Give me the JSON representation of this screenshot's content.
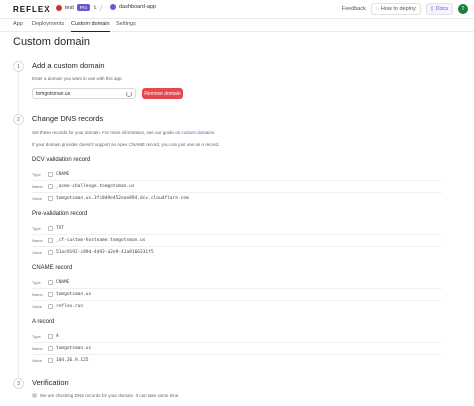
{
  "topbar": {
    "logo": "REFLEX",
    "team": "test",
    "team_badge": "Pro",
    "project": "dashboard-app",
    "feedback": "Feedback",
    "deploy": "How to deploy",
    "docs": "Docs",
    "user_initial": "T"
  },
  "tabs": [
    "App",
    "Deployments",
    "Custom domain",
    "Settings"
  ],
  "page_title": "Custom domain",
  "steps": [
    {
      "num": "1",
      "title": "Add a custom domain",
      "desc": "Enter a domain you want to use with this app."
    },
    {
      "num": "2",
      "title": "Change DNS records"
    },
    {
      "num": "3",
      "title": "Verification",
      "desc": "We are checking DNS records for your domain. It can take some time."
    }
  ],
  "domain": {
    "value": "tomgotsman.us",
    "remove_label": "Remove domain"
  },
  "dns": {
    "desc1_pre": "Set these records for your domain. For more information, see our guide on ",
    "desc1_link": "custom domains",
    "desc1_post": ".",
    "desc2": "If your domain provider doesn't support an Apex CNAME record, you can just use an A record."
  },
  "labels": {
    "type": "Type",
    "name": "Name",
    "value": "Value"
  },
  "records": [
    {
      "title": "DCV validation record",
      "type": "CNAME",
      "name": "_acme-challenge.tomgotsman.us",
      "value": "tomgotsman.us.3fc8d9e452eae894.dcv.cloudflare.com"
    },
    {
      "title": "Pre-validation record",
      "type": "TXT",
      "name": "_cf-custom-hostname.tomgotsman.us",
      "value": "51ac9192-c89d-4d93-a2e9-41a9166331f5"
    },
    {
      "title": "CNAME record",
      "type": "CNAME",
      "name": "tomgotsman.us",
      "value": "reflex.run"
    },
    {
      "title": "A record",
      "type": "A",
      "name": "tomgotsman.us",
      "value": "104.26.9.125"
    }
  ],
  "colors": {
    "accent": "#6e56cf",
    "danger": "#e5484d",
    "user": "#1a7f37"
  }
}
